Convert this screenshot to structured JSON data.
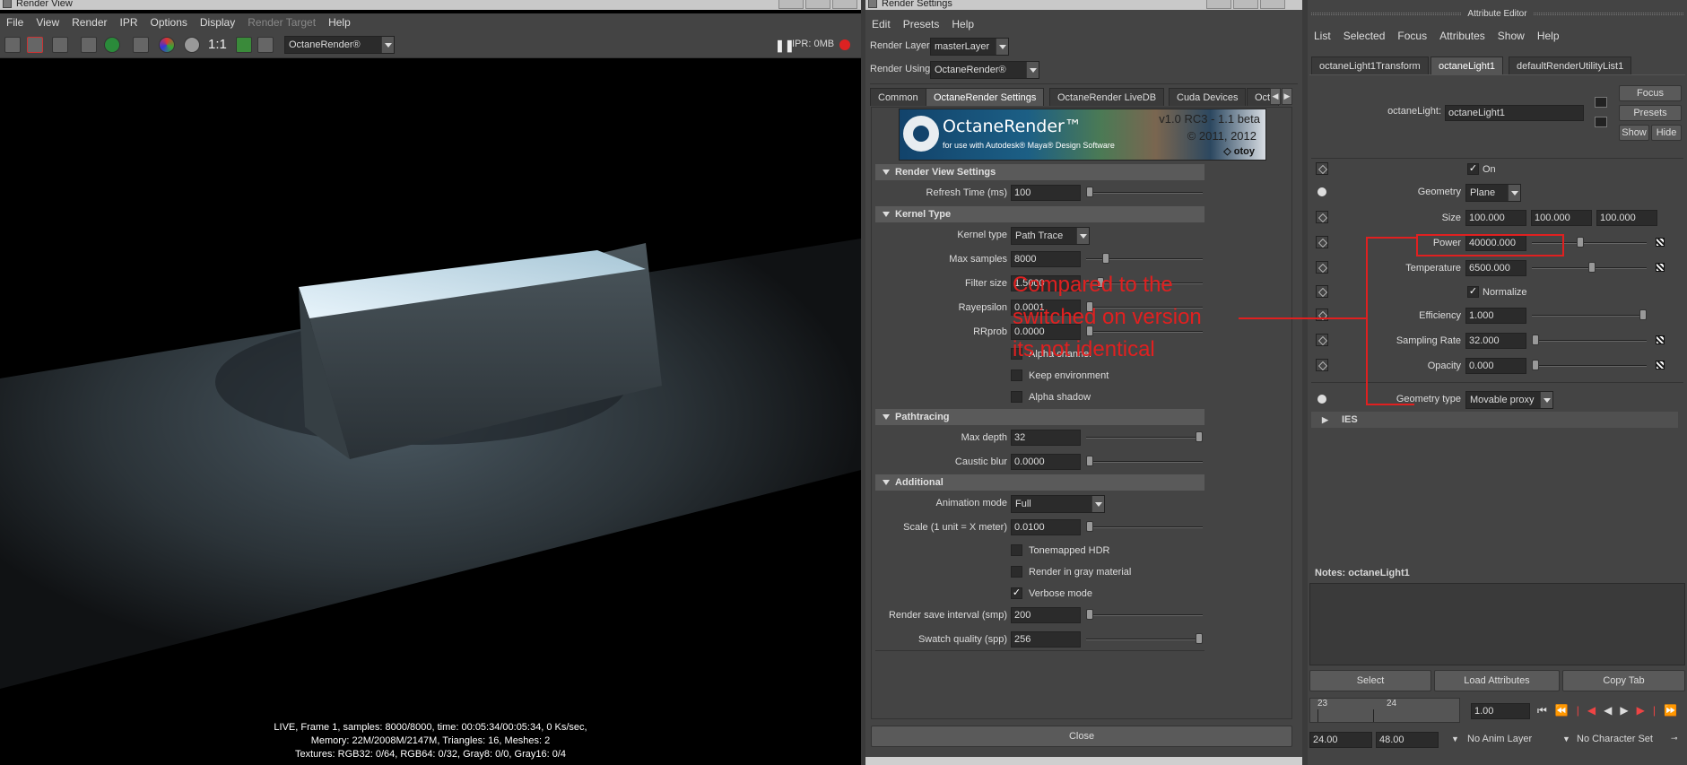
{
  "render_view": {
    "title": "Render View",
    "menu": [
      "File",
      "View",
      "Render",
      "IPR",
      "Options",
      "Display",
      "Render Target",
      "Help"
    ],
    "ratio_label": "1:1",
    "renderer": "OctaneRender®",
    "ipr_label": "IPR: 0MB",
    "pause_icon": "pause-icon",
    "stats": [
      "LIVE, Frame 1, samples: 8000/8000, time: 00:05:34/00:05:34, 0 Ks/sec,",
      "Memory: 22M/2008M/2147M, Triangles: 16, Meshes: 2",
      "Textures: RGB32: 0/64, RGB64: 0/32, Gray8: 0/0, Gray16: 0/4"
    ]
  },
  "render_settings": {
    "title": "Render Settings",
    "menu": [
      "Edit",
      "Presets",
      "Help"
    ],
    "render_layer_label": "Render Layer",
    "render_layer_value": "masterLayer",
    "render_using_label": "Render Using",
    "render_using_value": "OctaneRender®",
    "tabs": [
      "Common",
      "OctaneRender Settings",
      "OctaneRender LiveDB",
      "Cuda Devices",
      "Oct"
    ],
    "banner": {
      "product": "OctaneRender™",
      "subtitle": "for use with Autodesk® Maya® Design Software",
      "version": "v1.0 RC3 - 1.1 beta",
      "copyright": "© 2011, 2012",
      "company": "otoy"
    },
    "sections": {
      "render_view": "Render View Settings",
      "kernel": "Kernel Type",
      "pathtracing": "Pathtracing",
      "additional": "Additional"
    },
    "fields": {
      "refresh_time": {
        "label": "Refresh Time (ms)",
        "value": "100"
      },
      "kernel_type": {
        "label": "Kernel type",
        "value": "Path Trace"
      },
      "max_samples": {
        "label": "Max samples",
        "value": "8000"
      },
      "filter_size": {
        "label": "Filter size",
        "value": "1.5000"
      },
      "rayepsilon": {
        "label": "Rayepsilon",
        "value": "0.0001"
      },
      "rrprob": {
        "label": "RRprob",
        "value": "0.0000"
      },
      "max_depth": {
        "label": "Max depth",
        "value": "32"
      },
      "caustic_blur": {
        "label": "Caustic blur",
        "value": "0.0000"
      },
      "animation_mode": {
        "label": "Animation mode",
        "value": "Full"
      },
      "scale": {
        "label": "Scale (1 unit = X meter)",
        "value": "0.0100"
      },
      "render_save_interval": {
        "label": "Render save interval (smp)",
        "value": "200"
      },
      "swatch_quality": {
        "label": "Swatch quality (spp)",
        "value": "256"
      }
    },
    "checks": {
      "alpha_channel": "Alpha channel",
      "keep_environment": "Keep environment",
      "alpha_shadow": "Alpha shadow",
      "tonemapped_hdr": "Tonemapped HDR",
      "render_gray": "Render in gray material",
      "verbose": "Verbose mode"
    },
    "close_label": "Close"
  },
  "annotation": {
    "lines": [
      "Compared to the",
      "switched on version",
      "its not identical"
    ],
    "color": "#e02020"
  },
  "attribute_editor": {
    "title": "Attribute Editor",
    "menu": [
      "List",
      "Selected",
      "Focus",
      "Attributes",
      "Show",
      "Help"
    ],
    "tabs": [
      "octaneLight1Transform",
      "octaneLight1",
      "defaultRenderUtilityList1"
    ],
    "node_label": "octaneLight:",
    "node_value": "octaneLight1",
    "buttons": {
      "focus": "Focus",
      "presets": "Presets",
      "show": "Show",
      "hide": "Hide"
    },
    "on_label": "On",
    "geometry": {
      "label": "Geometry",
      "value": "Plane"
    },
    "size": {
      "label": "Size",
      "x": "100.000",
      "y": "100.000",
      "z": "100.000"
    },
    "power": {
      "label": "Power",
      "value": "40000.000"
    },
    "temperature": {
      "label": "Temperature",
      "value": "6500.000"
    },
    "normalize_label": "Normalize",
    "efficiency": {
      "label": "Efficiency",
      "value": "1.000"
    },
    "sampling_rate": {
      "label": "Sampling Rate",
      "value": "32.000"
    },
    "opacity": {
      "label": "Opacity",
      "value": "0.000"
    },
    "geometry_type": {
      "label": "Geometry type",
      "value": "Movable proxy"
    },
    "ies_label": "IES",
    "notes_label": "Notes:  octaneLight1",
    "bottom_buttons": {
      "select": "Select",
      "load": "Load Attributes",
      "copy": "Copy Tab"
    }
  },
  "timeline": {
    "frame_a": "23",
    "frame_b": "24",
    "current": "1.00",
    "start": "24.00",
    "end": "48.00",
    "anim_layer": "No Anim Layer",
    "char_set": "No Character Set"
  }
}
